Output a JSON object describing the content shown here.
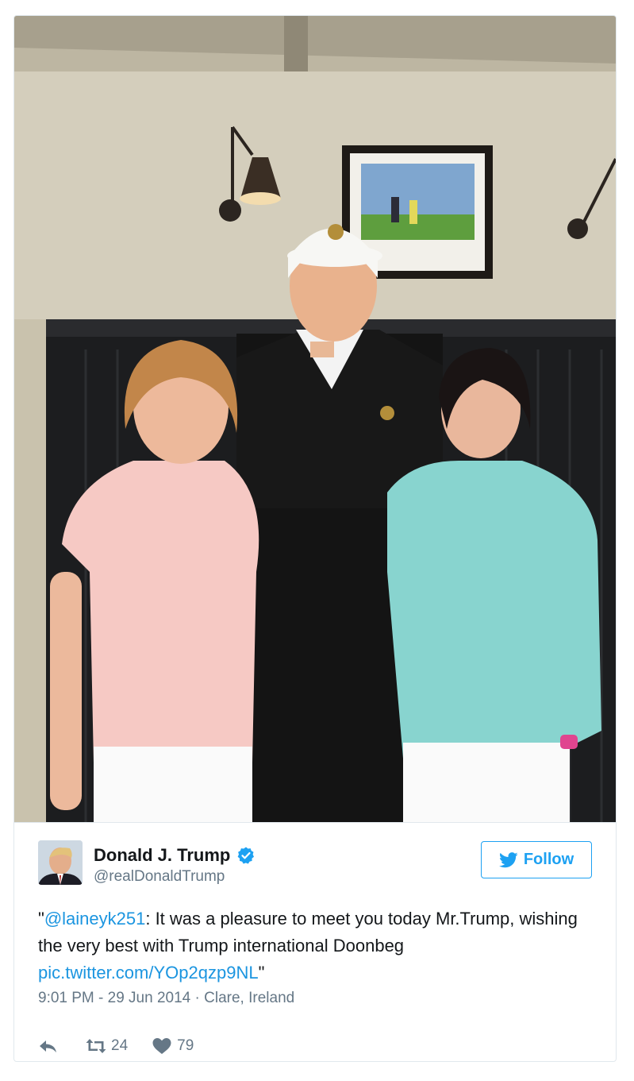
{
  "tweet": {
    "author_name": "Donald J. Trump",
    "author_handle": "@realDonaldTrump",
    "follow_label": "Follow",
    "text_open_quote": "\"",
    "mention": "@laineyk251",
    "text_body": ": It was a pleasure to meet you today Mr.Trump, wishing the very best with Trump international Doonbeg ",
    "pic_link": "pic.twitter.com/YOp2qzp9NL",
    "text_close_quote": "\"",
    "timestamp": "9:01 PM - 29 Jun 2014",
    "separator": "·",
    "location": "Clare, Ireland",
    "retweet_count": "24",
    "like_count": "79"
  },
  "icons": {
    "verified": "verified-badge-icon",
    "follow": "twitter-bird-icon",
    "reply": "reply-icon",
    "retweet": "retweet-icon",
    "like": "heart-icon"
  },
  "colors": {
    "brand_blue": "#1da1f2",
    "link_blue": "#1b95e0",
    "muted_gray": "#657786",
    "text_dark": "#14171a"
  }
}
